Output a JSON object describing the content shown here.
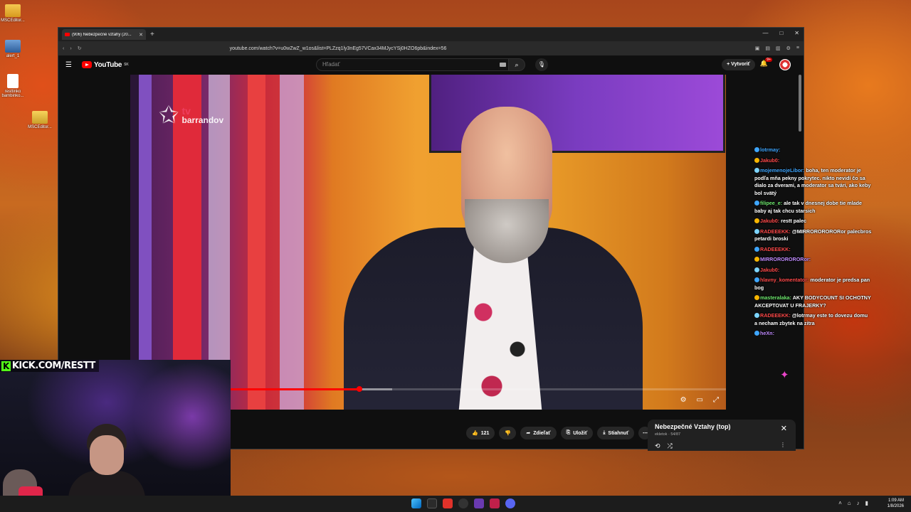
{
  "desktop": {
    "icons": [
      {
        "label": "MSCEditor..."
      },
      {
        "label": "alert_1"
      },
      {
        "label": "resttinko bambinko..."
      },
      {
        "label": "MSCEditor..."
      }
    ]
  },
  "browser": {
    "tab_title": "(906) Nebezpečné vztahy (20...",
    "url": "youtube.com/watch?v=u0wZwZ_w1os&list=PLZzq1ly3nEg57VCax34MJycYSj0HZO6pb&index=56"
  },
  "youtube": {
    "logo_text": "YouTube",
    "logo_region": "SK",
    "search_placeholder": "Hľadať",
    "create_label": "Vytvoriť",
    "notif_badge": "9+",
    "like_count": "121",
    "share_label": "Zdieľať",
    "save_label": "Uložiť",
    "download_label": "Stiahnuť",
    "progress_fraction": 0.385
  },
  "video": {
    "channel_logo_top": "tv",
    "channel_logo_bottom": "barrandov"
  },
  "playlist": {
    "title": "Nebezpečné Vztahy (top)",
    "subtitle": "ekletok · 54/87"
  },
  "chat": [
    {
      "user": "lotrmay:",
      "color": "#3ea6ff",
      "text": ""
    },
    {
      "user": "Jakub0:",
      "color": "#ff4a4a",
      "text": ""
    },
    {
      "user": "mojemenojeLibor:",
      "color": "#3ea6ff",
      "text": "boha, ten moderator je podľa mňa pekny pokrytec. nikto nevidí čo sa dialo za dverami, a moderator sa tvári, ako keby bol svätý"
    },
    {
      "user": "filipee_e:",
      "color": "#6ee86e",
      "text": "ale tak v dnesnej dobe tie mlade baby aj tak chcu starsich"
    },
    {
      "user": "Jakub0:",
      "color": "#ff4a4a",
      "text": "restt palec"
    },
    {
      "user": "RADEEEKK:",
      "color": "#ff4a4a",
      "text": "@MIRRORORORORor palecbros petardi broski"
    },
    {
      "user": "RADEEEKK:",
      "color": "#ff4a4a",
      "text": ""
    },
    {
      "user": "MIRRORORORORor:",
      "color": "#c08cff",
      "text": ""
    },
    {
      "user": "Jakub0:",
      "color": "#ff4a4a",
      "text": ""
    },
    {
      "user": "hlavny_komentator:",
      "color": "#ff4a4a",
      "text": "moderator je predsa pan bog"
    },
    {
      "user": "masteralaka:",
      "color": "#6ee86e",
      "text": "AKY BODYCOUNT SI OCHOTNY AKCEPTOVAT U FRAJERKY?"
    },
    {
      "user": "RADEEEKK:",
      "color": "#ff4a4a",
      "text": "@lotrmay este to dovezu domu a necham zbytek na zitra"
    },
    {
      "user": "heXn:",
      "color": "#c08cff",
      "text": ""
    }
  ],
  "webcam": {
    "kick_label": "KICK.COM/RESTT"
  },
  "taskbar": {
    "time": "1:09 AM",
    "date": "1/8/2026"
  },
  "colors": {
    "yt_red": "#ff0000",
    "kick_green": "#53fc18"
  }
}
